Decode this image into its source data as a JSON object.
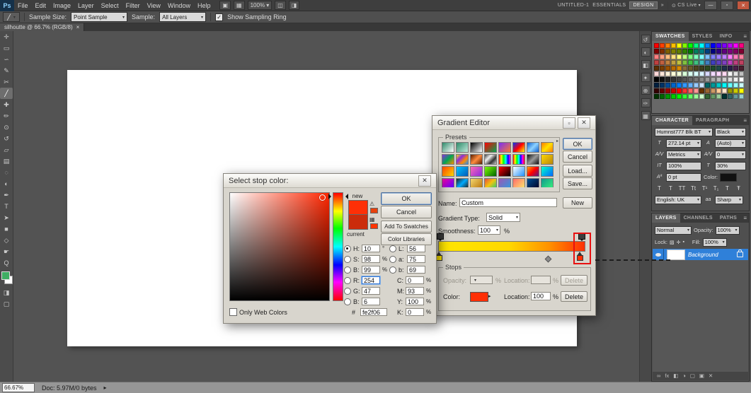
{
  "menubar": {
    "logo": "Ps",
    "items": [
      "File",
      "Edit",
      "Image",
      "Layer",
      "Select",
      "Filter",
      "View",
      "Window",
      "Help"
    ],
    "icons": [
      {
        "name": "bridge-icon",
        "glyph": "▣"
      },
      {
        "name": "view-extras-icon",
        "glyph": "▦"
      },
      {
        "name": "zoom-level-dropdown",
        "text": "100%"
      },
      {
        "name": "arrange-documents-icon",
        "glyph": "◫"
      },
      {
        "name": "screen-mode-icon",
        "glyph": "◨"
      }
    ],
    "doc_name": "UNTITLED-1",
    "workspaces": [
      "ESSENTIALS",
      "DESIGN"
    ],
    "overflow": "»",
    "cs_live": "CS Live",
    "window_buttons": {
      "minimize": "—",
      "restore": "▫",
      "close": "✕"
    }
  },
  "options": {
    "sample_size_label": "Sample Size:",
    "sample_size_value": "Point Sample",
    "sample_label": "Sample:",
    "sample_value": "All Layers",
    "sampling_ring_label": "Show Sampling Ring",
    "check_glyph": "✓",
    "tool_chip_glyph": "╱"
  },
  "doc_tab": {
    "title": "silhoutte @ 66.7% (RGB/8)",
    "close": "×"
  },
  "tools": [
    {
      "name": "move-tool",
      "glyph": "✛"
    },
    {
      "name": "rectangular-marquee-tool",
      "glyph": "▭"
    },
    {
      "name": "lasso-tool",
      "glyph": "∽"
    },
    {
      "name": "quick-selection-tool",
      "glyph": "✎"
    },
    {
      "name": "crop-tool",
      "glyph": "✂"
    },
    {
      "name": "eyedropper-tool",
      "glyph": "╱",
      "selected": true
    },
    {
      "name": "spot-healing-brush-tool",
      "glyph": "✚"
    },
    {
      "name": "brush-tool",
      "glyph": "✏"
    },
    {
      "name": "clone-stamp-tool",
      "glyph": "⊙"
    },
    {
      "name": "history-brush-tool",
      "glyph": "↺"
    },
    {
      "name": "eraser-tool",
      "glyph": "▱"
    },
    {
      "name": "gradient-tool",
      "glyph": "▤"
    },
    {
      "name": "blur-tool",
      "glyph": "◌"
    },
    {
      "name": "dodge-tool",
      "glyph": "◐"
    },
    {
      "name": "pen-tool",
      "glyph": "✒"
    },
    {
      "name": "type-tool",
      "glyph": "T"
    },
    {
      "name": "path-selection-tool",
      "glyph": "➤"
    },
    {
      "name": "rectangle-tool",
      "glyph": "■"
    },
    {
      "name": "3d-rotate-tool",
      "glyph": "◇"
    },
    {
      "name": "hand-tool",
      "glyph": "☛"
    },
    {
      "name": "zoom-tool",
      "glyph": "Q"
    }
  ],
  "tool_colors": {
    "foreground": "#3fae63",
    "background": "#ffffff"
  },
  "toolbar_extra": [
    {
      "name": "quick-mask-icon",
      "glyph": "◨"
    },
    {
      "name": "screen-mode-cycle-icon",
      "glyph": "▢"
    }
  ],
  "panel_dock_icons": [
    {
      "name": "history-icon",
      "glyph": "↺"
    },
    {
      "name": "adjustments-icon",
      "glyph": "◐"
    },
    {
      "name": "masks-icon",
      "glyph": "◧"
    },
    {
      "name": "styles-icon",
      "glyph": "✦"
    },
    {
      "name": "clone-source-icon",
      "glyph": "⊕"
    },
    {
      "name": "brush-presets-icon",
      "glyph": "✑"
    },
    {
      "name": "info-icon",
      "glyph": "▦"
    }
  ],
  "swatches_panel": {
    "tabs": [
      "SWATCHES",
      "STYLES",
      "INFO"
    ],
    "colors": [
      "#ff0000",
      "#ff4000",
      "#ff8000",
      "#ffbf00",
      "#ffff00",
      "#80ff00",
      "#00ff00",
      "#00ff80",
      "#00ffff",
      "#0080ff",
      "#0000ff",
      "#4000ff",
      "#8000ff",
      "#bf00ff",
      "#ff00ff",
      "#ff0080",
      "#800000",
      "#803000",
      "#806000",
      "#808000",
      "#608000",
      "#308000",
      "#008000",
      "#008060",
      "#008080",
      "#004080",
      "#000080",
      "#300080",
      "#600080",
      "#800080",
      "#800060",
      "#800030",
      "#ff8080",
      "#ffa080",
      "#ffc080",
      "#ffe080",
      "#ffff80",
      "#c0ff80",
      "#80ff80",
      "#80ffc0",
      "#80ffff",
      "#80c0ff",
      "#8080ff",
      "#a080ff",
      "#c080ff",
      "#ff80ff",
      "#ff80c0",
      "#ff80a0",
      "#c04040",
      "#c06040",
      "#c08040",
      "#c0a040",
      "#c0c040",
      "#80c040",
      "#40c040",
      "#40c080",
      "#40c0c0",
      "#4080c0",
      "#4040c0",
      "#6040c0",
      "#8040c0",
      "#c040c0",
      "#c04080",
      "#c04060",
      "#5c2e00",
      "#7a3e00",
      "#995200",
      "#b86b00",
      "#d68a00",
      "#8a6d3b",
      "#6b5b2a",
      "#4f4520",
      "#3e3e1f",
      "#2e4a1f",
      "#1f4a2e",
      "#1f4a4a",
      "#1f2e4a",
      "#2a1f4a",
      "#4a1f4a",
      "#4a1f2e",
      "#ffd9d9",
      "#ffe6d9",
      "#fff2d9",
      "#ffffd9",
      "#f2ffd9",
      "#d9ffd9",
      "#d9fff2",
      "#d9ffff",
      "#d9f2ff",
      "#d9d9ff",
      "#f2d9ff",
      "#ffd9ff",
      "#ffd9f2",
      "#f5f5f5",
      "#e0e0e0",
      "#c0c0c0",
      "#000000",
      "#111111",
      "#222222",
      "#333333",
      "#444444",
      "#555555",
      "#666666",
      "#777777",
      "#888888",
      "#999999",
      "#aaaaaa",
      "#bbbbbb",
      "#cccccc",
      "#dddddd",
      "#eeeeee",
      "#ffffff",
      "#001f3f",
      "#003366",
      "#004c99",
      "#0066cc",
      "#0080ff",
      "#3399ff",
      "#66b2ff",
      "#99ccff",
      "#cce5ff",
      "#006666",
      "#009999",
      "#00cccc",
      "#00ffff",
      "#66ffff",
      "#99ffff",
      "#ccffff",
      "#330000",
      "#660000",
      "#990000",
      "#cc0000",
      "#ff0000",
      "#ff3333",
      "#ff6666",
      "#ff9999",
      "#663300",
      "#996633",
      "#cc9966",
      "#ffcc99",
      "#ffe5cc",
      "#999900",
      "#cccc00",
      "#ffff00",
      "#003300",
      "#006600",
      "#009900",
      "#00cc00",
      "#00ff00",
      "#33ff33",
      "#66ff66",
      "#99ff99",
      "#ccffcc",
      "#336633",
      "#669966",
      "#99cc99",
      "#003333",
      "#336666",
      "#669999",
      "#99cccc"
    ]
  },
  "character_panel": {
    "tabs": [
      "CHARACTER",
      "PARAGRAPH"
    ],
    "font_family": "Humnst777 Blk BT",
    "font_style": "Black",
    "icons": {
      "size": "T",
      "leading": "A",
      "kerning": "A/V",
      "tracking": "A/V",
      "vscale": "IT",
      "hscale": "T",
      "baseline": "Aª",
      "aa": "aa"
    },
    "size": "272.14 pt",
    "leading": "(Auto)",
    "kerning": "Metrics",
    "tracking": "0",
    "vscale": "100%",
    "hscale": "30%",
    "baseline": "0 pt",
    "color_label": "Color:",
    "color_value": "#111111",
    "style_buttons": [
      "T",
      "T",
      "TT",
      "Tt",
      "T¹",
      "T₁",
      "T",
      "Ŧ"
    ],
    "language": "English: UK",
    "aa_value": "Sharp"
  },
  "layers_panel": {
    "tabs": [
      "LAYERS",
      "CHANNELS",
      "PATHS"
    ],
    "blend_mode": "Normal",
    "opacity_label": "Opacity:",
    "opacity": "100%",
    "lock_label": "Lock:",
    "lock_icons": [
      {
        "name": "lock-transparency-icon",
        "glyph": "▨"
      },
      {
        "name": "lock-position-icon",
        "glyph": "✛"
      },
      {
        "name": "lock-all-icon",
        "glyph": "▪"
      }
    ],
    "fill_label": "Fill:",
    "fill": "100%",
    "layer_name": "Background",
    "bottom_icons": [
      {
        "name": "link-layers-icon",
        "glyph": "∞"
      },
      {
        "name": "layer-style-icon",
        "glyph": "fx"
      },
      {
        "name": "add-layer-mask-icon",
        "glyph": "◧"
      },
      {
        "name": "new-adjustment-layer-icon",
        "glyph": "◑"
      },
      {
        "name": "new-group-icon",
        "glyph": "▢"
      },
      {
        "name": "new-layer-icon",
        "glyph": "▣"
      },
      {
        "name": "delete-layer-icon",
        "glyph": "✕"
      }
    ]
  },
  "statusbar": {
    "zoom": "66.67%",
    "doc_info": "Doc: 5.97M/0 bytes",
    "flyout": "▸"
  },
  "gradient_editor": {
    "title": "Gradient Editor",
    "window_icons": {
      "restore": "▫",
      "close": "✕"
    },
    "presets_label": "Presets",
    "presets_scroll": "▸",
    "presets": [
      "linear-gradient(135deg,#2e8b6a,#ffffff)",
      "linear-gradient(135deg,#2e8b6a,#bfe8da)",
      "linear-gradient(135deg,#000000,#ffffff)",
      "linear-gradient(135deg,#ff0000,#00a651)",
      "linear-gradient(135deg,#7b2ff7,#f77b2f)",
      "linear-gradient(135deg,#0033ff,#ff0000,#ffff00)",
      "linear-gradient(135deg,#0b5fd0,#8fd3ff,#0b5fd0)",
      "linear-gradient(135deg,#ff7a00,#ffe100,#ff7a00)",
      "linear-gradient(135deg,#8a2be2,#00a651,#ff8c00)",
      "linear-gradient(135deg,#ffe100,#8a2be2,#ff8c00,#1e90ff)",
      "linear-gradient(135deg,#5c1f00,#ff8c3f,#5c1f00)",
      "linear-gradient(135deg,#444444,#eeeeee,#333333,#cccccc)",
      "linear-gradient(90deg,#ff0000,#ffff00,#00ff00,#00ffff,#0000ff,#ff00ff)",
      "linear-gradient(90deg,#ff0000,#ffff00,#00ff00,#00ffff,#0000ff,#ff00ff,#ff0000)",
      "linear-gradient(135deg,#111111,#999999,#111111)",
      "linear-gradient(135deg,#ffd700,#b8860b)",
      "linear-gradient(135deg,#ff4500,#ffd700)",
      "linear-gradient(135deg,#00c3ff,#005bbb)",
      "linear-gradient(135deg,#ff69b4,#8a2be2)",
      "linear-gradient(135deg,#7cfc00,#006400)",
      "linear-gradient(135deg,#ff0000,#000000)",
      "linear-gradient(135deg,#ffffff,#1e90ff)",
      "linear-gradient(135deg,#ffa500,#ff0000,#551a8b)",
      "linear-gradient(135deg,#00ffcc,#0066ff)",
      "linear-gradient(135deg,#ff00aa,#5500ff)",
      "linear-gradient(135deg,#222222,#00aaff,#222222)",
      "linear-gradient(135deg,#f5d76e,#b9770e)",
      "linear-gradient(135deg,#e74c3c,#f1c40f,#2ecc71)",
      "linear-gradient(135deg,#9b59b6,#3498db)",
      "linear-gradient(135deg,#ff6b6b,#ffe66d)",
      "linear-gradient(135deg,#004e92,#000428)",
      "linear-gradient(135deg,#11998e,#38ef7d)"
    ],
    "ok": "OK",
    "cancel": "Cancel",
    "load": "Load...",
    "save": "Save...",
    "name_label": "Name:",
    "name_value": "Custom",
    "new_button": "New",
    "type_label": "Gradient Type:",
    "type_value": "Solid",
    "smoothness_label": "Smoothness:",
    "smoothness_value": "100",
    "percent": "%",
    "bar_gradient": "linear-gradient(90deg,#ffe600 0%,#ffd800 48%,#ff9000 76%,#fe2f06 100%)",
    "start_stop_color": "#ffe600",
    "end_stop_color": "#fe2f06",
    "stops_label": "Stops",
    "opacity_label": "Opacity:",
    "location_label": "Location:",
    "color_label": "Color:",
    "stop_location": "100",
    "delete": "Delete"
  },
  "color_picker": {
    "title": "Select stop color:",
    "close": "✕",
    "field_css": "linear-gradient(to top,#000,rgba(0,0,0,0)),linear-gradient(to right,#fff,rgba(255,255,255,0)),#ff2600",
    "hue_css": "linear-gradient(#ff0000,#ffff00 17%,#00ff00 33%,#00ffff 50%,#0000ff 67%,#ff00ff 83%,#ff0000)",
    "new_label": "new",
    "current_label": "current",
    "new_color": "#fe2f06",
    "current_color": "#cb2c0c",
    "gamut_warning_glyph": "⚠",
    "web_cube_glyph": "▦",
    "ok": "OK",
    "cancel": "Cancel",
    "add_to_swatches": "Add To Swatches",
    "color_libraries": "Color Libraries",
    "fields_left": [
      {
        "name": "hue",
        "label": "H:",
        "value": "10",
        "unit": "°",
        "radio": true,
        "checked": true
      },
      {
        "name": "saturation",
        "label": "S:",
        "value": "98",
        "unit": "%",
        "radio": true
      },
      {
        "name": "brightness",
        "label": "B:",
        "value": "99",
        "unit": "%",
        "radio": true
      },
      {
        "name": "red",
        "label": "R:",
        "value": "254",
        "unit": "",
        "radio": true,
        "focus": true
      },
      {
        "name": "green",
        "label": "G:",
        "value": "47",
        "unit": "",
        "radio": true
      },
      {
        "name": "blue",
        "label": "B:",
        "value": "6",
        "unit": "",
        "radio": true
      }
    ],
    "fields_right": [
      {
        "name": "lab-l",
        "label": "L:",
        "value": "56",
        "unit": "",
        "radio": true
      },
      {
        "name": "lab-a",
        "label": "a:",
        "value": "75",
        "unit": "",
        "radio": true
      },
      {
        "name": "lab-b",
        "label": "b:",
        "value": "69",
        "unit": "",
        "radio": true
      },
      {
        "name": "cyan",
        "label": "C:",
        "value": "0",
        "unit": "%",
        "radio": false
      },
      {
        "name": "magenta",
        "label": "M:",
        "value": "93",
        "unit": "%",
        "radio": false
      },
      {
        "name": "yellow",
        "label": "Y:",
        "value": "100",
        "unit": "%",
        "radio": false
      },
      {
        "name": "black",
        "label": "K:",
        "value": "0",
        "unit": "%",
        "radio": false
      }
    ],
    "hex_label": "#",
    "hex_value": "fe2f06",
    "only_web": "Only Web Colors"
  },
  "annotation": {
    "box_color": "#e81010"
  }
}
